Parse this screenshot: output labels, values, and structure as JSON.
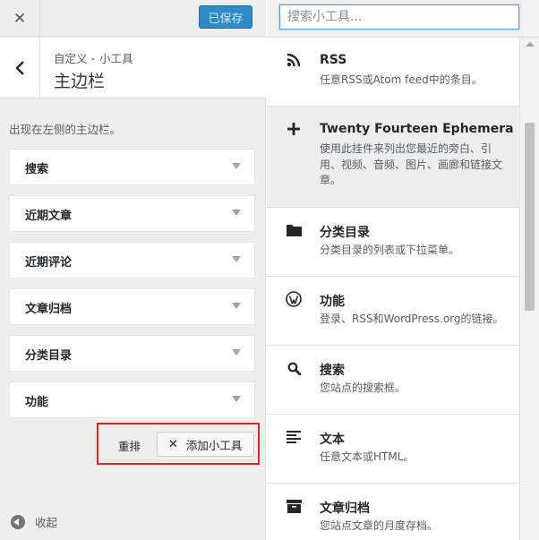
{
  "topbar": {
    "close_icon": "close-icon",
    "saved_label": "已保存"
  },
  "panel": {
    "breadcrumb_parent": "自定义",
    "breadcrumb_child": "小工具",
    "title": "主边栏",
    "description": "出现在左侧的主边栏。"
  },
  "sidebar_widgets": [
    {
      "title": "搜索"
    },
    {
      "title": "近期文章"
    },
    {
      "title": "近期评论"
    },
    {
      "title": "文章归档"
    },
    {
      "title": "分类目录"
    },
    {
      "title": "功能"
    }
  ],
  "actions": {
    "reorder_label": "重排",
    "add_widget_label": "添加小工具"
  },
  "footer": {
    "collapse_label": "收起"
  },
  "search": {
    "placeholder": "搜索小工具..."
  },
  "available_widgets": [
    {
      "title": "RSS",
      "description": "任意RSS或Atom feed中的条目。",
      "icon": "rss-icon"
    },
    {
      "title": "Twenty Fourteen Ephemera",
      "description": "使用此挂件来列出您最近的旁白、引用、视频、音频、图片、画廊和链接文章。",
      "icon": "plus-icon"
    },
    {
      "title": "分类目录",
      "description": "分类目录的列表或下拉菜单。",
      "icon": "folder-icon"
    },
    {
      "title": "功能",
      "description": "登录、RSS和WordPress.org的链接。",
      "icon": "wordpress-icon"
    },
    {
      "title": "搜索",
      "description": "您站点的搜索框。",
      "icon": "search-icon"
    },
    {
      "title": "文本",
      "description": "任意文本或HTML。",
      "icon": "text-icon"
    },
    {
      "title": "文章归档",
      "description": "您站点文章的月度存档。",
      "icon": "archive-icon"
    }
  ],
  "colors": {
    "accent": "#2e8bc5",
    "highlight": "#e0261f",
    "panel_bg": "#eeeeee"
  }
}
